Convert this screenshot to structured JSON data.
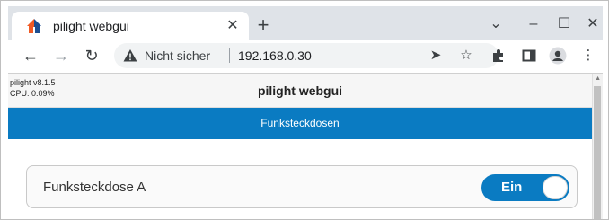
{
  "browser": {
    "tab": {
      "title": "pilight webgui",
      "favicon": "house-icon",
      "close_icon": "close-icon"
    },
    "new_tab_icon": "plus-icon",
    "window_controls": [
      "chevron-down-icon",
      "minimize-icon",
      "maximize-icon",
      "close-icon"
    ],
    "toolbar": {
      "nav_icons": [
        "back-arrow-icon",
        "forward-arrow-icon",
        "reload-icon"
      ],
      "security_icon": "warning-triangle-icon",
      "security_label": "Nicht sicher",
      "url": "192.168.0.30",
      "omnibox_icons": [
        "send-icon",
        "star-icon"
      ],
      "action_icons": [
        "extensions-puzzle-icon",
        "side-panel-icon",
        "profile-icon",
        "more-vert-icon"
      ]
    }
  },
  "page": {
    "version": "pilight v8.1.5",
    "cpu": "CPU: 0.09%",
    "title": "pilight webgui",
    "nav_item": "Funksteckdosen",
    "device": {
      "label": "Funksteckdose A",
      "state_label": "Ein",
      "state_on": true
    },
    "accent_color": "#0a7bc2"
  }
}
